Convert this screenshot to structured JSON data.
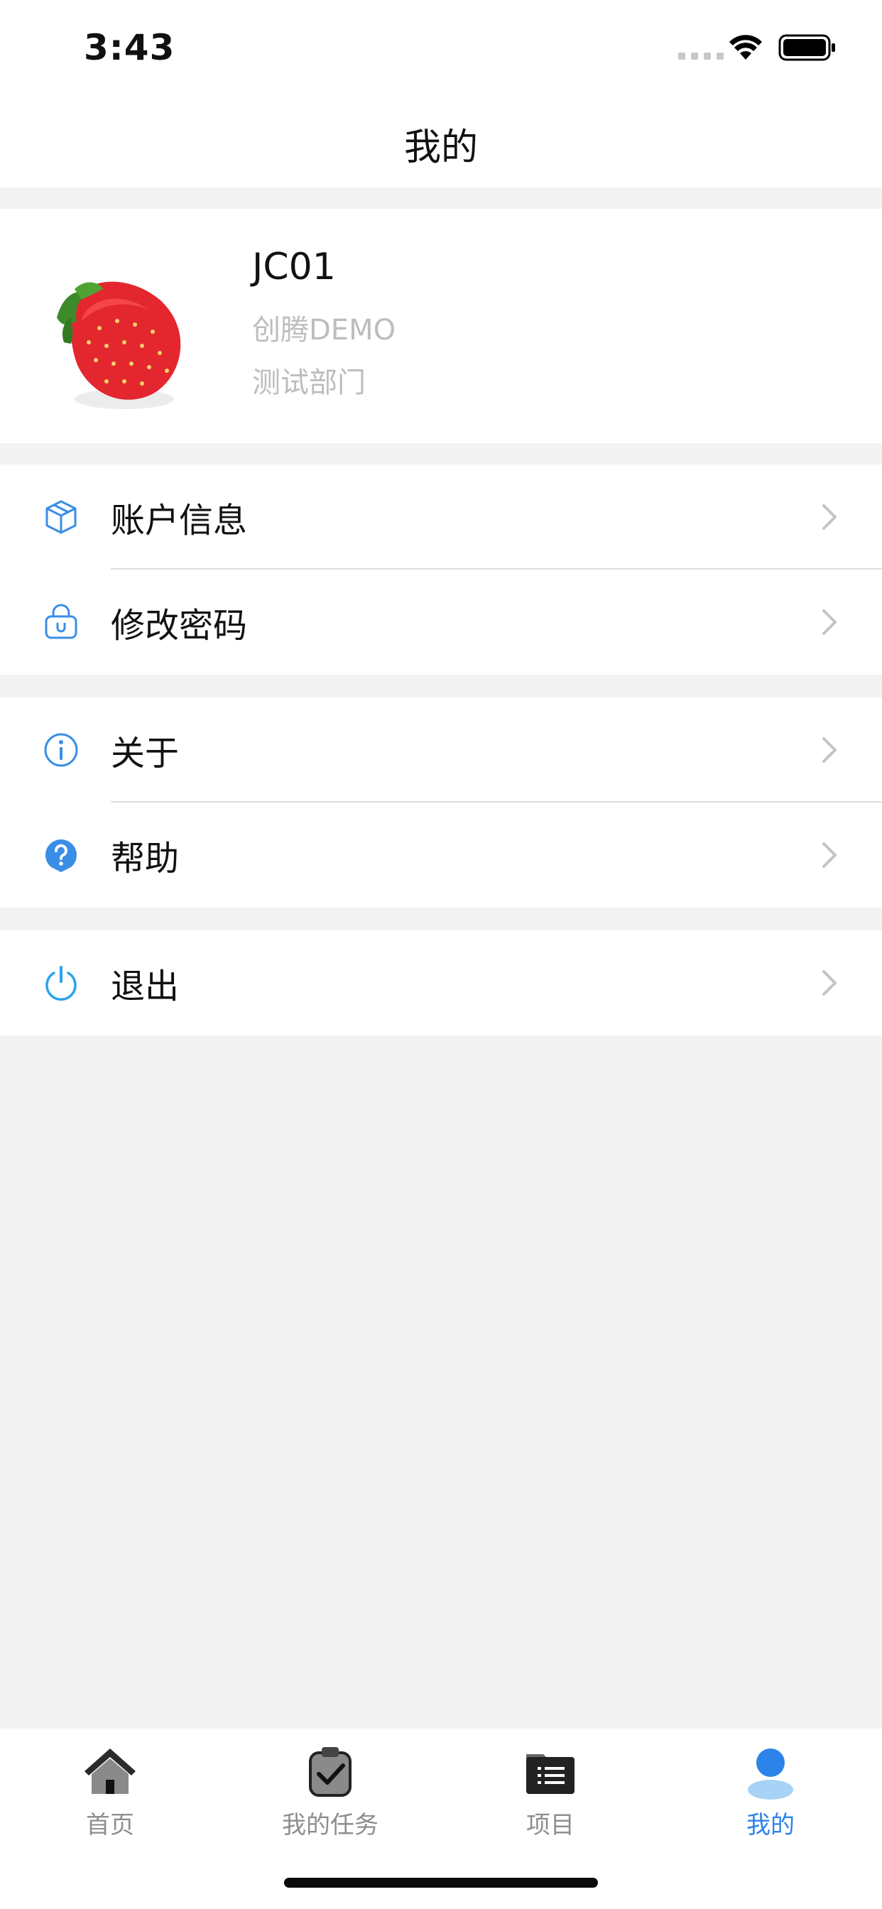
{
  "status_bar": {
    "time": "3:43"
  },
  "nav": {
    "title": "我的"
  },
  "profile": {
    "name": "JC01",
    "company": "创腾DEMO",
    "department": "测试部门"
  },
  "menu_groups": [
    [
      {
        "label": "账户信息",
        "icon": "cube-icon"
      },
      {
        "label": "修改密码",
        "icon": "lock-icon"
      }
    ],
    [
      {
        "label": "关于",
        "icon": "info-icon"
      },
      {
        "label": "帮助",
        "icon": "help-icon"
      }
    ],
    [
      {
        "label": "退出",
        "icon": "power-icon"
      }
    ]
  ],
  "tabs": [
    {
      "label": "首页",
      "icon": "home-icon"
    },
    {
      "label": "我的任务",
      "icon": "task-icon"
    },
    {
      "label": "项目",
      "icon": "project-icon"
    },
    {
      "label": "我的",
      "icon": "user-icon",
      "active": true
    }
  ],
  "colors": {
    "accent": "#2c83ea",
    "icon_blue": "#3a8ee6",
    "background": "#f3f3f3"
  }
}
